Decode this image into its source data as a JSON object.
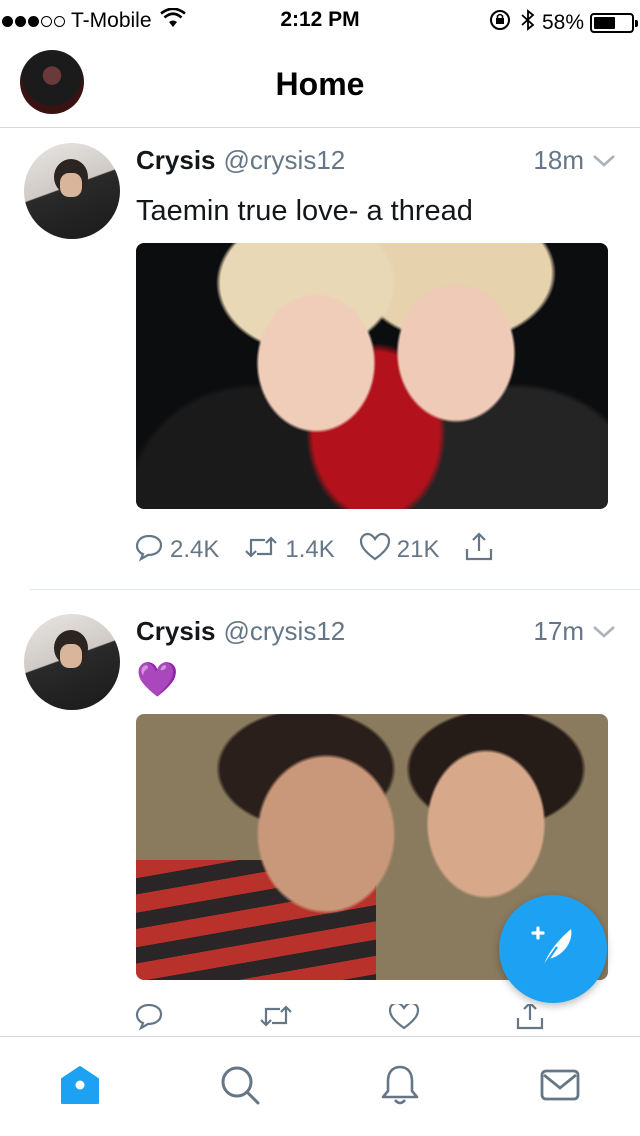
{
  "status_bar": {
    "carrier": "T-Mobile",
    "time": "2:12 PM",
    "battery": "58%",
    "battery_level": 0.58
  },
  "nav": {
    "title": "Home"
  },
  "tweets": [
    {
      "name": "Crysis",
      "handle": "@crysis12",
      "time": "18m",
      "text": "Taemin true love- a thread",
      "replies": "2.4K",
      "retweets": "1.4K",
      "likes": "21K"
    },
    {
      "name": "Crysis",
      "handle": "@crysis12",
      "time": "17m",
      "text": "💜",
      "replies": "",
      "retweets": "",
      "likes": ""
    }
  ],
  "colors": {
    "accent": "#1da1f2",
    "secondary_text": "#657786",
    "divider": "#e1e8ed"
  },
  "icons": {
    "tabs": [
      "home-icon",
      "search-icon",
      "notifications-icon",
      "messages-icon"
    ],
    "compose": "compose-tweet-icon"
  }
}
